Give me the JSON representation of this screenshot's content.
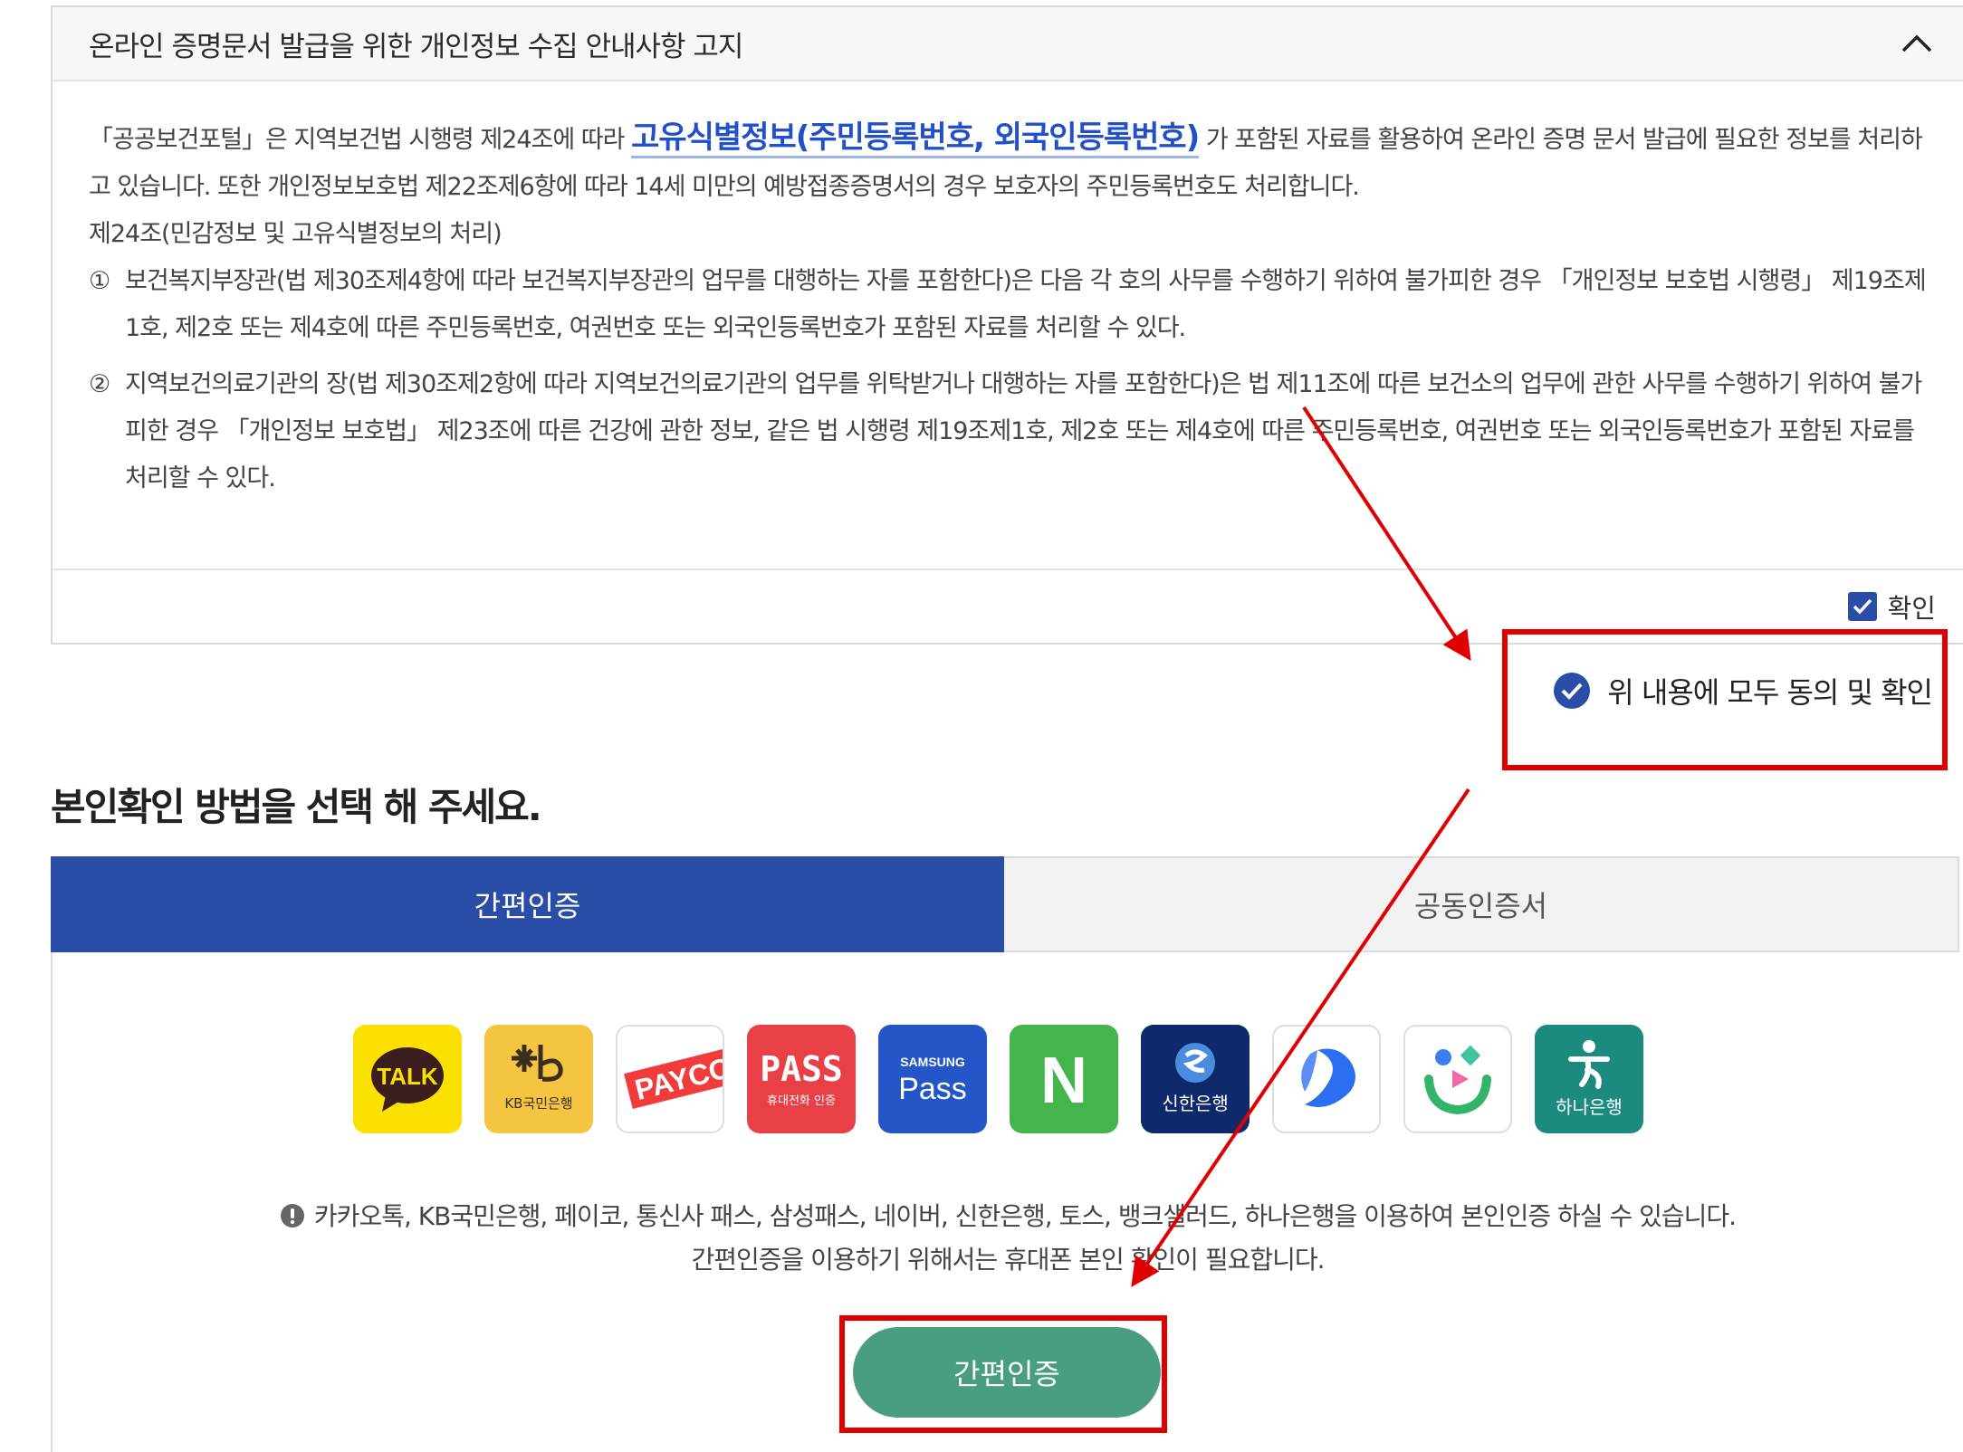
{
  "notice": {
    "title": "온라인 증명문서 발급을 위한 개인정보 수집 안내사항 고지",
    "para1_before": "「공공보건포털」은 지역보건법 시행령 제24조에 따라 ",
    "para1_highlight": "고유식별정보(주민등록번호, 외국인등록번호)",
    "para1_after": " 가 포함된 자료를 활용하여 온라인 증명 문서 발급에 필요한 정보를 처리하고 있습니다. 또한 개인정보보호법 제22조제6항에 따라 14세 미만의 예방접종증명서의 경우 보호자의 주민등록번호도 처리합니다.",
    "article_title": "제24조(민감정보 및 고유식별정보의 처리)",
    "item1_num": "①",
    "item1_text": "보건복지부장관(법 제30조제4항에 따라 보건복지부장관의 업무를 대행하는 자를 포함한다)은 다음 각 호의 사무를 수행하기 위하여 불가피한 경우 「개인정보 보호법 시행령」 제19조제1호, 제2호 또는 제4호에 따른 주민등록번호, 여권번호 또는 외국인등록번호가 포함된 자료를 처리할 수 있다.",
    "item2_num": "②",
    "item2_text": "지역보건의료기관의 장(법 제30조제2항에 따라 지역보건의료기관의 업무를 위탁받거나 대행하는 자를 포함한다)은 법 제11조에 따른 보건소의 업무에 관한 사무를 수행하기 위하여 불가피한 경우 「개인정보 보호법」 제23조에 따른 건강에 관한 정보, 같은 법 시행령 제19조제1호, 제2호 또는 제4호에 따른 주민등록번호, 여권번호 또는 외국인등록번호가 포함된 자료를 처리할 수 있다.",
    "confirm_label": "확인",
    "confirm_checked": true
  },
  "agree_all": {
    "label": "위 내용에 모두 동의 및 확인",
    "checked": true
  },
  "method_title": "본인확인 방법을 선택 해 주세요.",
  "tabs": [
    {
      "label": "간편인증",
      "active": true
    },
    {
      "label": "공동인증서",
      "active": false
    }
  ],
  "providers": {
    "kakao": {
      "text": "TALK",
      "icon": "kakao-talk-icon"
    },
    "kb": {
      "text": "KB국민은행",
      "icon": "kb-star-icon"
    },
    "payco": {
      "text": "PAYCO",
      "icon": "payco-icon"
    },
    "pass": {
      "text": "PASS",
      "sub": "휴대전화 인증",
      "icon": "pass-icon"
    },
    "samsung": {
      "text1": "SAMSUNG",
      "text2": "Pass",
      "icon": "samsung-pass-icon"
    },
    "naver": {
      "text": "N",
      "icon": "naver-icon"
    },
    "shinhan": {
      "text": "신한은행",
      "icon": "shinhan-icon"
    },
    "toss": {
      "icon": "toss-icon"
    },
    "banksalad": {
      "icon": "banksalad-icon"
    },
    "hana": {
      "text": "하나은행",
      "icon": "hana-icon"
    }
  },
  "description": {
    "line1": "카카오톡, KB국민은행, 페이코, 통신사 패스, 삼성패스, 네이버, 신한은행, 토스, 뱅크샐러드, 하나은행을 이용하여 본인인증 하실 수 있습니다.",
    "line2": "간편인증을 이용하기 위해서는 휴대폰 본인 확인이 필요합니다."
  },
  "auth_button_label": "간편인증",
  "colors": {
    "primary_blue": "#2a4ea8",
    "link_blue": "#2150c9",
    "button_green": "#4a9e80",
    "annotation_red": "#e00000"
  }
}
